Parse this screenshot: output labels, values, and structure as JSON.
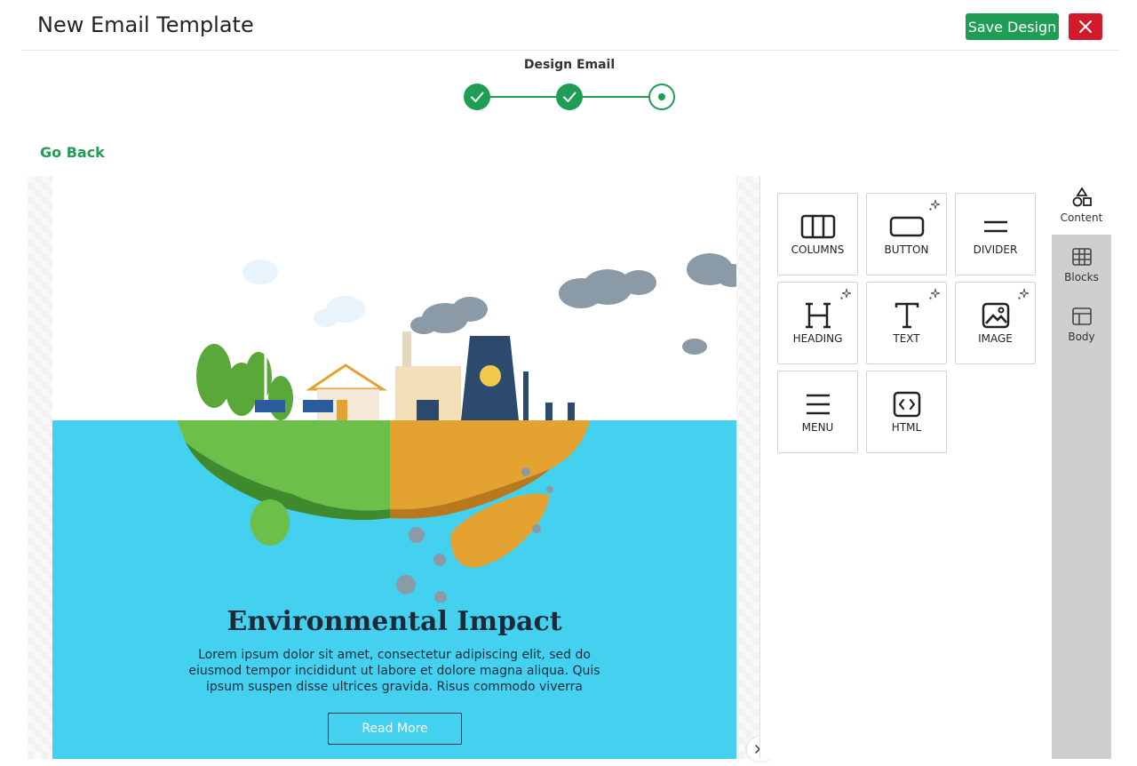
{
  "header": {
    "title": "New Email Template",
    "save_label": "Save Design",
    "close_icon": "close-icon"
  },
  "stepper": {
    "label": "Design Email",
    "steps": [
      {
        "state": "done"
      },
      {
        "state": "done"
      },
      {
        "state": "current"
      }
    ]
  },
  "nav": {
    "go_back": "Go Back"
  },
  "email": {
    "hero_image": "environmental-impact-illustration",
    "title": "Environmental Impact",
    "body": "Lorem ipsum dolor sit amet, consectetur adipiscing elit, sed do eiusmod tempor incididunt ut labore et dolore magna aliqua. Quis ipsum suspen disse ultrices gravida. Risus commodo viverra",
    "button": "Read More"
  },
  "content_tools": [
    {
      "label": "COLUMNS",
      "icon": "columns-icon",
      "ai": false
    },
    {
      "label": "BUTTON",
      "icon": "button-icon",
      "ai": true
    },
    {
      "label": "DIVIDER",
      "icon": "divider-icon",
      "ai": false
    },
    {
      "label": "HEADING",
      "icon": "heading-icon",
      "ai": true
    },
    {
      "label": "TEXT",
      "icon": "text-icon",
      "ai": true
    },
    {
      "label": "IMAGE",
      "icon": "image-icon",
      "ai": true
    },
    {
      "label": "MENU",
      "icon": "menu-icon",
      "ai": false
    },
    {
      "label": "HTML",
      "icon": "html-icon",
      "ai": false
    }
  ],
  "side_tabs": [
    {
      "label": "Content",
      "icon": "shapes-icon",
      "active": true
    },
    {
      "label": "Blocks",
      "icon": "blocks-icon",
      "active": false
    },
    {
      "label": "Body",
      "icon": "body-icon",
      "active": false
    }
  ],
  "colors": {
    "accent": "#1f9d55",
    "danger": "#d11a2a",
    "email_bg": "#43d1ef"
  }
}
